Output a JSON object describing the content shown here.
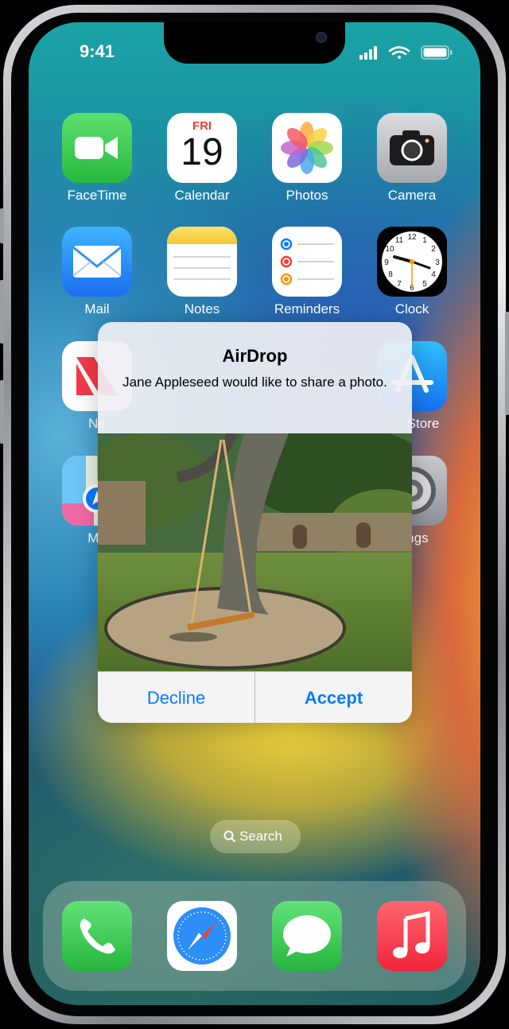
{
  "status_bar": {
    "time": "9:41"
  },
  "home_apps": [
    {
      "label": "FaceTime",
      "icon": "facetime-icon"
    },
    {
      "label": "Calendar",
      "icon": "calendar-icon",
      "day": "FRI",
      "date": "19"
    },
    {
      "label": "Photos",
      "icon": "photos-icon"
    },
    {
      "label": "Camera",
      "icon": "camera-icon"
    },
    {
      "label": "Mail",
      "icon": "mail-icon"
    },
    {
      "label": "Notes",
      "icon": "notes-icon"
    },
    {
      "label": "Reminders",
      "icon": "reminders-icon"
    },
    {
      "label": "Clock",
      "icon": "clock-icon"
    },
    {
      "label": "News",
      "icon": "news-icon",
      "visible_label": "Ne"
    },
    {
      "label": "App Store",
      "icon": "app-store-icon",
      "visible_label": "Store"
    },
    {
      "label": "Maps",
      "icon": "maps-icon",
      "visible_label": "Ma"
    },
    {
      "label": "Settings",
      "icon": "settings-icon",
      "visible_label": "ings"
    }
  ],
  "alert": {
    "title": "AirDrop",
    "message": "Jane Appleseed would like to share a photo.",
    "decline_label": "Decline",
    "accept_label": "Accept"
  },
  "search": {
    "label": "Search"
  },
  "dock": [
    {
      "icon": "phone-icon"
    },
    {
      "icon": "safari-icon"
    },
    {
      "icon": "messages-icon"
    },
    {
      "icon": "music-icon"
    }
  ],
  "colors": {
    "accent_blue": "#0a7aff",
    "facetime_green": "#34c759",
    "music_red": "#fc3c44"
  }
}
